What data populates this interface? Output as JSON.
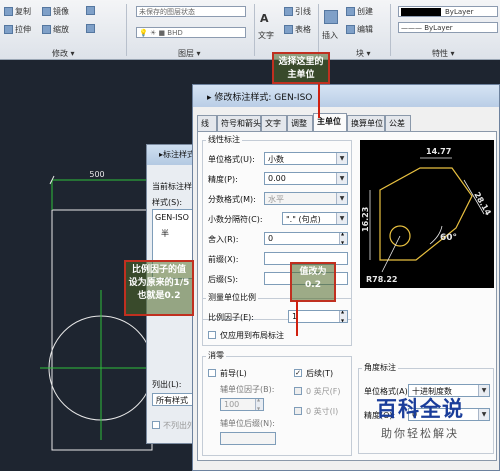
{
  "ribbon": {
    "modify_panel_label": "修改 ▾",
    "layers_panel_label": "图层 ▾",
    "block_panel_label": "块 ▾",
    "properties_panel_label": "特性 ▾",
    "layer_state_value": "未保存的图层状态",
    "text_label": "文字",
    "insert_label": "插入",
    "leader_label": "引线",
    "table_label": "表格",
    "create_label": "创建",
    "edit_label": "编辑",
    "bylayer_color": "ByLayer",
    "bylayer_line": "——— ByLayer",
    "modify_items": [
      "复制",
      "镜像",
      "拉伸",
      "缩放"
    ],
    "layer_current": "BHD"
  },
  "drawing": {
    "dimension_text": "500"
  },
  "back_dialog": {
    "title": "标注样式管理器",
    "current_style_label": "当前标注样式:",
    "styles_label": "样式(S):",
    "style_item": "GEN-ISO",
    "half_label": "半",
    "list_label": "列出(L):",
    "list_value": "所有样式",
    "checkbox_label": "不列出外"
  },
  "dialog": {
    "title": "修改标注样式: GEN-ISO",
    "tabs": [
      "线",
      "符号和箭头",
      "文字",
      "调整",
      "主单位",
      "换算单位",
      "公差"
    ],
    "active_tab": "主单位",
    "linear_section": "线性标注",
    "unit_format_label": "单位格式(U):",
    "unit_format_value": "小数",
    "precision_label": "精度(P):",
    "precision_value": "0.00",
    "fraction_format_label": "分数格式(M):",
    "fraction_format_value": "水平",
    "decimal_sep_label": "小数分隔符(C):",
    "decimal_sep_value": "\".\" (句点)",
    "round_off_label": "舍入(R):",
    "round_off_value": "0",
    "prefix_label": "前缀(X):",
    "suffix_label": "后缀(S):",
    "scale_section": "测量单位比例",
    "scale_factor_label": "比例因子(E):",
    "scale_factor_value": "1",
    "layout_only_label": "仅应用到布局标注",
    "zero_section": "消零",
    "leading_label": "前导(L)",
    "trailing_label": "后续(T)",
    "sub_factor_label": "辅单位因子(B):",
    "sub_factor_value": "100",
    "sub_suffix_label": "辅单位后缀(N):",
    "feet_label": "0 英尺(F)",
    "inch_label": "0 英寸(I)",
    "angular_section": "角度标注",
    "ang_format_label": "单位格式(A):",
    "ang_format_value": "十进制度数",
    "ang_precision_label": "精度(O):",
    "ang_precision_value": "0"
  },
  "preview": {
    "dim_top": "14.77",
    "dim_left": "16.23",
    "dim_right": "28.14",
    "dim_angle": "60°",
    "dim_radius": "R78.22"
  },
  "annotations": {
    "note_primary_unit": "选择这里的主单位",
    "note_scale_factor": "比例因子的值设为原来的1/5也就是0.2",
    "note_change_to": "值改为0.2"
  },
  "watermark": {
    "main": "百科全说",
    "sub": "助你轻松解决"
  },
  "colors": {
    "annotation_border": "#c03020",
    "canvas_bg": "#1e2530",
    "drawing_line": "#e8e8e8",
    "dim_line": "#2fbf3a",
    "watermark": "#1a3d9a"
  }
}
